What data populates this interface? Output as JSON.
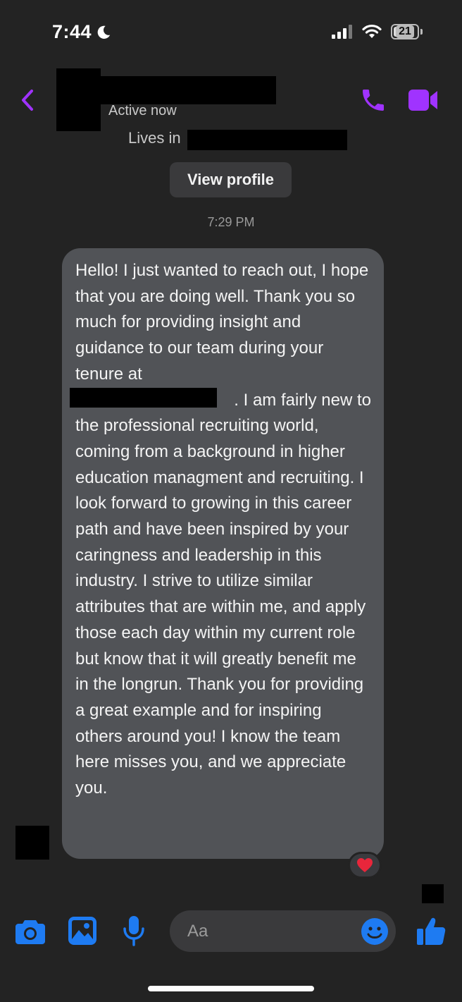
{
  "status_bar": {
    "time": "7:44",
    "battery": "21"
  },
  "header": {
    "active_status": "Active now",
    "location_label": "Lives in",
    "view_profile_label": "View profile"
  },
  "thread": {
    "timestamp": "7:29 PM",
    "message": {
      "before_redaction": "Hello! I just wanted to reach out, I hope that you are doing well. Thank you so much for providing insight and guidance to our team during your tenure at",
      "after_redaction_first_line": ". I am fairly new to",
      "after_redaction": "the professional recruiting world, coming from a background in higher education managment and recruiting. I look forward to growing in this career path and have been inspired by your caringness and leadership in this industry. I strive to utilize similar attributes that are within me, and apply those each day within my current role but know that it will greatly benefit me in the longrun. Thank you for providing a great example and for inspiring others around you! I know the team here misses you, and we appreciate you."
    },
    "reaction_icon": "heart-icon"
  },
  "composer": {
    "placeholder": "Aa"
  },
  "colors": {
    "accent_purple": "#a033ff",
    "accent_blue": "#1e7bf2",
    "background": "#232323",
    "bubble": "#515357"
  }
}
